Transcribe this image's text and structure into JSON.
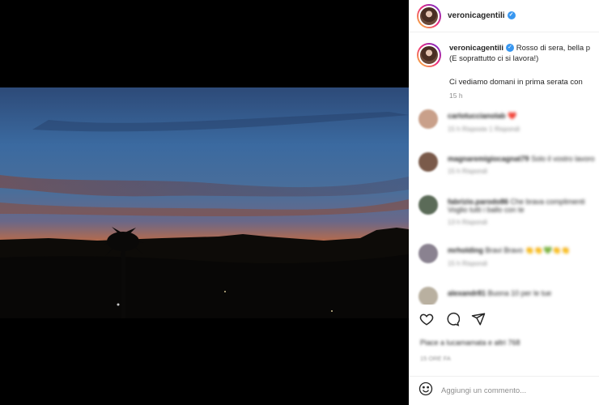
{
  "post": {
    "username": "veronicagentili",
    "caption_line1": "Rosso di sera, bella p",
    "caption_line2": "(E soprattutto ci si lavora!)",
    "caption_line3": "Ci vediamo domani in prima serata con",
    "time": "15 h"
  },
  "comments": [
    {
      "user": "carlotuccianolab",
      "text": "❤️",
      "meta": "15 h  Risposte 1  Rispondi",
      "color": "#c9a08a"
    },
    {
      "user": "magnaremigiocagnat79",
      "text": "Solo il vostro lavoro",
      "meta": "15 h  Rispondi",
      "color": "#7a5a4a"
    },
    {
      "user": "fabrizio.parodo86",
      "text": "Che brava complimenti",
      "text2": "Voglio tutti i ballo con te",
      "meta": "13 h  Rispondi",
      "color": "#5b6b58"
    },
    {
      "user": "mrholding",
      "text": "Bravi Bravo 👏👏💚👏👏",
      "meta": "15 h  Rispondi",
      "color": "#8a8290"
    },
    {
      "user": "alexandr81",
      "text": "Buona 10 per le tue",
      "meta": "",
      "color": "#b9b0a0"
    }
  ],
  "actions": {
    "like_icon": "heart-icon",
    "comment_icon": "comment-icon",
    "share_icon": "share-icon"
  },
  "likes": {
    "text": "Piace a lucamamata e altri 768",
    "time": "15 ORE FA"
  },
  "add_comment": {
    "placeholder": "Aggiungi un commento..."
  }
}
